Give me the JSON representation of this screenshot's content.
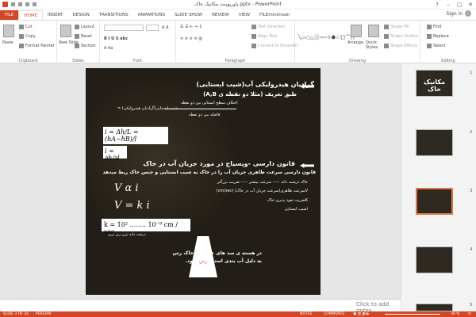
{
  "window": {
    "title": "پاورپوینت مکانیک خاک.pptx - PowerPoint",
    "min": "–",
    "max": "▢",
    "close": "✕",
    "help": "?",
    "signin": "Sign in"
  },
  "tabs": [
    "FILE",
    "HOME",
    "INSERT",
    "DESIGN",
    "TRANSITIONS",
    "ANIMATIONS",
    "SLIDE SHOW",
    "REVIEW",
    "VIEW",
    "FILEminimizer"
  ],
  "ribbon": {
    "clipboard": {
      "paste": "Paste",
      "cut": "Cut",
      "copy": "Copy",
      "format_painter": "Format Painter",
      "label": "Clipboard"
    },
    "slides": {
      "new_slide": "New Slide",
      "layout": "Layout",
      "reset": "Reset",
      "section": "Section",
      "label": "Slides"
    },
    "font": {
      "label": "Font"
    },
    "paragraph": {
      "text_direction": "Text Direction",
      "align_text": "Align Text",
      "smartart": "Convert to SmartArt",
      "label": "Paragraph"
    },
    "drawing": {
      "arrange": "Arrange",
      "quick_styles": "Quick Styles",
      "shape_fill": "Shape Fill",
      "shape_outline": "Shape Outline",
      "shape_effects": "Shape Effects",
      "label": "Drawing"
    },
    "editing": {
      "find": "Find",
      "replace": "Replace",
      "select": "Select",
      "label": "Editing"
    }
  },
  "thumbnails": [
    {
      "num": "1",
      "title": "مکانیک خاک"
    },
    {
      "num": "2"
    },
    {
      "num": "3"
    },
    {
      "num": "4"
    },
    {
      "num": "5"
    }
  ],
  "slide": {
    "h1": "گرادیان هیدرولیکی آب(شیب ابستایی)",
    "h1b": "طبق تعریف (مثلا دو نقطه ی A,B)",
    "frac_num": "اختلاف سطح ابستایی بین دو نقطه",
    "frac_den": "فاصله بین دو نقطه",
    "frac_eq": "= شیب ابستایی(گرادیان هیدرولیکی)",
    "h2": "قانون دارسی -وپسیاج در مورد جریان آب در خاک",
    "p1": "قانون دارسی سرعت ظاهری جریان آب را در خاک به شیب ابستایی و جنس خاک ربط میدهد",
    "p2": "خاک درشت دانه ----- سرعت بیشتر -----  ضریب بزرگتر",
    "p3": "Vسرعت ظاهری(سرعت جریان آب در خاک) (cm/sec)",
    "p4": "Kضریب نفوذ پذیری خاک",
    "p5": "iشیب ابستایی",
    "f1": "V α i",
    "f2": "V = k i",
    "f3": "k = 10² ........ 10⁻⁹ cm / sec",
    "f3cap": "درشت دانه ترین        ریز ترین",
    "label_res": "رس",
    "p6": "در هسته ی سد های خاکی از خاک رس",
    "p7": "به دلیل آب بندی استفاده میشود."
  },
  "notes": "Click to add notes",
  "status": {
    "slide": "SLIDE 3 OF 34",
    "lang": "PERSIAN",
    "notes": "NOTES",
    "comments": "COMMENTS",
    "zoom": "39 %"
  }
}
